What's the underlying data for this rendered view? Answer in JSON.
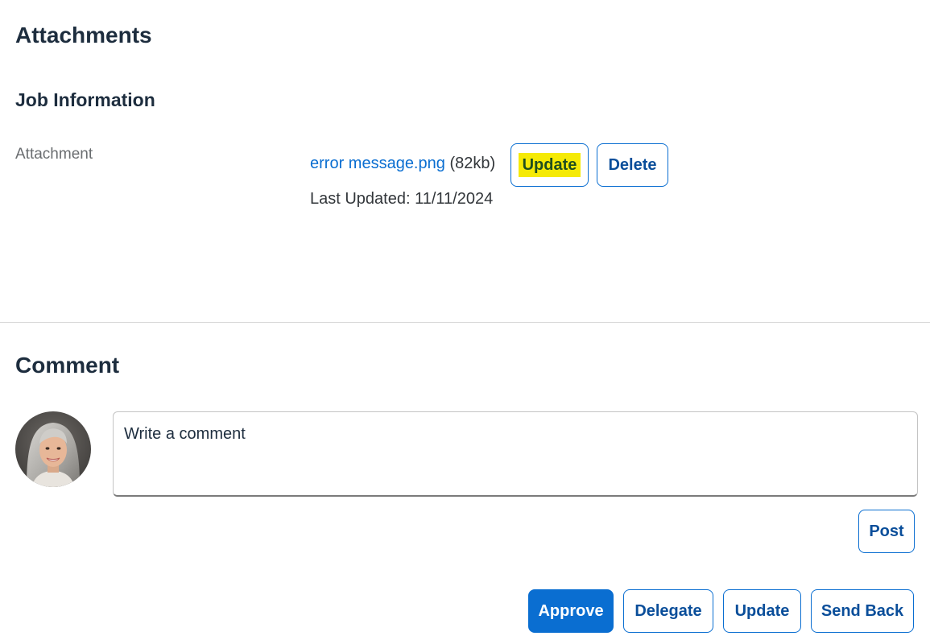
{
  "attachments": {
    "title": "Attachments",
    "section_title": "Job Information",
    "field_label": "Attachment",
    "file": {
      "name": "error message.png",
      "size": "(82kb)",
      "update_label": "Update",
      "delete_label": "Delete",
      "last_updated": "Last Updated: 11/11/2024"
    }
  },
  "comment": {
    "title": "Comment",
    "placeholder": "Write a comment",
    "post_label": "Post"
  },
  "actions": {
    "approve_label": "Approve",
    "delegate_label": "Delegate",
    "update_label": "Update",
    "send_back_label": "Send Back"
  },
  "colors": {
    "primary": "#0a6ed1",
    "highlight": "#f5ea06",
    "divider": "#d9d9d9"
  }
}
